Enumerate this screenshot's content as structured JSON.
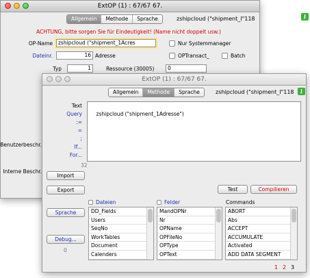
{
  "back_window": {
    "title": "ExtOP (1) : 67/67 67.",
    "tabs": [
      "Allgemein",
      "Methode",
      "Sprache"
    ],
    "header_text": "zshipcloud (\"shipment_I\"118",
    "corner_badge": "J",
    "warning": "ACHTUNG, bitte sorgen Sie für Eindeutigkeit! (Name nicht doppelt usw.)",
    "op_name_label": "OP-Name",
    "op_name_value": "zshipcloud (\"shipment_1Acres",
    "nur_systemmanager_label": "Nur Systemmanager",
    "dateinr_label": "Dateinr.",
    "dateinr_value": "16",
    "adresse_label": "Adresse",
    "optransact_label": "OPTransact_",
    "batch_label": "Batch",
    "typ_label": "Typ",
    "typ_value": "1",
    "ressource_label": "Ressource (30005)",
    "ressource_value": "0"
  },
  "front_window": {
    "title": "ExtOP (1) : 67/67 67.",
    "tabs": [
      "Allgemein",
      "Methode",
      "Sprache"
    ],
    "header_text": "zshipcloud (\"shipment_I\"118",
    "corner_badge": "J",
    "text_label": "Text",
    "text_value": "zshipcloud (\"shipment_1Adresse\")",
    "side_labels": [
      "Query",
      ":=",
      "=",
      ";",
      "If...",
      "For..."
    ],
    "benutzerbeschr_label": "Benutzerbeschr.",
    "interne_beschr_label": "Interne Beschr.",
    "count_value": "32",
    "import_button": "Import",
    "export_button": "Export",
    "test_button": "Test",
    "compile_button": "Compilieren",
    "sprache_button": "Sprache",
    "debug_button": "Debug...",
    "zero_value": "0",
    "dateien_header": "Dateien",
    "felder_header": "Felder",
    "commands_header": "Commands",
    "dateien": [
      "DD_Fields",
      "Users",
      "SeqNo",
      "WorkTables",
      "Document",
      "Calenders"
    ],
    "felder": [
      "MandOPNr",
      "Nr",
      "OPName",
      "OPFileNo",
      "OPType",
      "OPText"
    ],
    "commands": [
      "ABORT",
      "Abs",
      "ACCEPT",
      "ACCUMULATE",
      "Activated",
      "ADD DATA SEGMENT"
    ],
    "pages": [
      "1",
      "2",
      "3"
    ],
    "accent_red": "#d00000",
    "accent_blue": "#1d2fb0"
  }
}
